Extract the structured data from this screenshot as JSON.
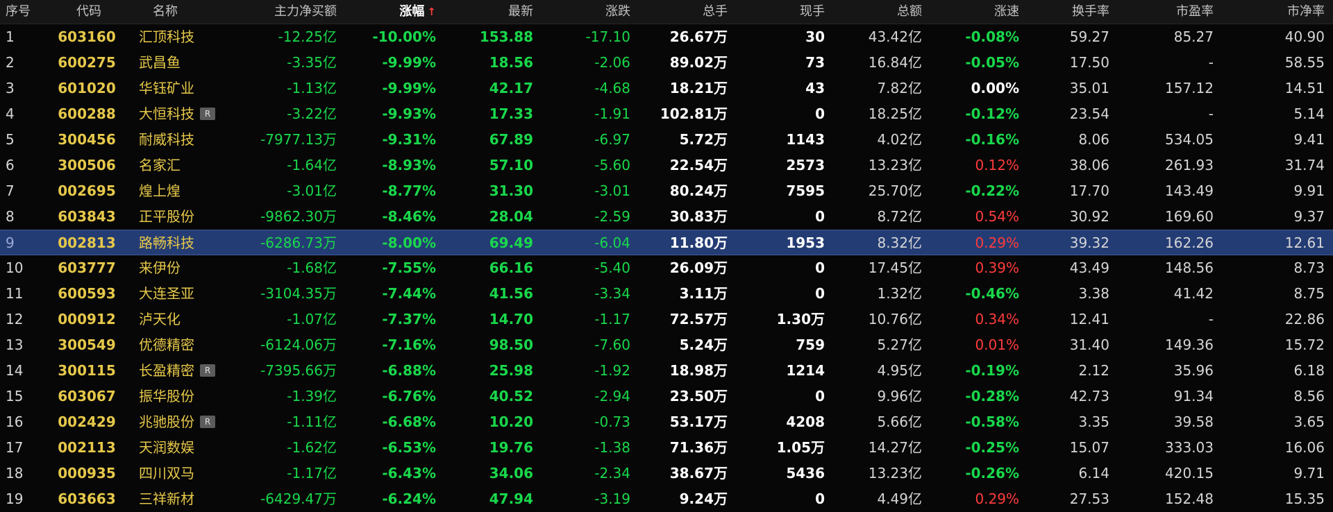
{
  "columns": [
    {
      "key": "idx",
      "label": "序号"
    },
    {
      "key": "code",
      "label": "代码"
    },
    {
      "key": "name",
      "label": "名称"
    },
    {
      "key": "main",
      "label": "主力净买额"
    },
    {
      "key": "pct",
      "label": "涨幅",
      "sorted": true
    },
    {
      "key": "last",
      "label": "最新"
    },
    {
      "key": "chg",
      "label": "涨跌"
    },
    {
      "key": "vol",
      "label": "总手"
    },
    {
      "key": "cur",
      "label": "现手"
    },
    {
      "key": "amt",
      "label": "总额"
    },
    {
      "key": "spd",
      "label": "涨速"
    },
    {
      "key": "turn",
      "label": "换手率"
    },
    {
      "key": "pe",
      "label": "市盈率"
    },
    {
      "key": "pb",
      "label": "市净率"
    }
  ],
  "sort_arrow": "↑",
  "badge_text": "R",
  "selected_row": 9,
  "colors": {
    "up": "#ff3b3b",
    "down": "#19d84b",
    "code": "#e6c84a",
    "selected_bg": "#243c74"
  },
  "rows": [
    {
      "idx": "1",
      "code": "603160",
      "name": "汇顶科技",
      "badge": false,
      "main": "-12.25亿",
      "pct": "-10.00%",
      "last": "153.88",
      "chg": "-17.10",
      "vol": "26.67万",
      "cur": "30",
      "amt": "43.42亿",
      "spd": "-0.08%",
      "spd_dir": "down",
      "turn": "59.27",
      "pe": "85.27",
      "pb": "40.90"
    },
    {
      "idx": "2",
      "code": "600275",
      "name": "武昌鱼",
      "badge": false,
      "main": "-3.35亿",
      "pct": "-9.99%",
      "last": "18.56",
      "chg": "-2.06",
      "vol": "89.02万",
      "cur": "73",
      "amt": "16.84亿",
      "spd": "-0.05%",
      "spd_dir": "down",
      "turn": "17.50",
      "pe": "-",
      "pb": "58.55"
    },
    {
      "idx": "3",
      "code": "601020",
      "name": "华钰矿业",
      "badge": false,
      "main": "-1.13亿",
      "pct": "-9.99%",
      "last": "42.17",
      "chg": "-4.68",
      "vol": "18.21万",
      "cur": "43",
      "amt": "7.82亿",
      "spd": "0.00%",
      "spd_dir": "flat",
      "turn": "35.01",
      "pe": "157.12",
      "pb": "14.51"
    },
    {
      "idx": "4",
      "code": "600288",
      "name": "大恒科技",
      "badge": true,
      "main": "-3.22亿",
      "pct": "-9.93%",
      "last": "17.33",
      "chg": "-1.91",
      "vol": "102.81万",
      "cur": "0",
      "amt": "18.25亿",
      "spd": "-0.12%",
      "spd_dir": "down",
      "turn": "23.54",
      "pe": "-",
      "pb": "5.14"
    },
    {
      "idx": "5",
      "code": "300456",
      "name": "耐威科技",
      "badge": false,
      "main": "-7977.13万",
      "pct": "-9.31%",
      "last": "67.89",
      "chg": "-6.97",
      "vol": "5.72万",
      "cur": "1143",
      "amt": "4.02亿",
      "spd": "-0.16%",
      "spd_dir": "down",
      "turn": "8.06",
      "pe": "534.05",
      "pb": "9.41"
    },
    {
      "idx": "6",
      "code": "300506",
      "name": "名家汇",
      "badge": false,
      "main": "-1.64亿",
      "pct": "-8.93%",
      "last": "57.10",
      "chg": "-5.60",
      "vol": "22.54万",
      "cur": "2573",
      "amt": "13.23亿",
      "spd": "0.12%",
      "spd_dir": "up",
      "turn": "38.06",
      "pe": "261.93",
      "pb": "31.74"
    },
    {
      "idx": "7",
      "code": "002695",
      "name": "煌上煌",
      "badge": false,
      "main": "-3.01亿",
      "pct": "-8.77%",
      "last": "31.30",
      "chg": "-3.01",
      "vol": "80.24万",
      "cur": "7595",
      "amt": "25.70亿",
      "spd": "-0.22%",
      "spd_dir": "down",
      "turn": "17.70",
      "pe": "143.49",
      "pb": "9.91"
    },
    {
      "idx": "8",
      "code": "603843",
      "name": "正平股份",
      "badge": false,
      "main": "-9862.30万",
      "pct": "-8.46%",
      "last": "28.04",
      "chg": "-2.59",
      "vol": "30.83万",
      "cur": "0",
      "amt": "8.72亿",
      "spd": "0.54%",
      "spd_dir": "up",
      "turn": "30.92",
      "pe": "169.60",
      "pb": "9.37"
    },
    {
      "idx": "9",
      "code": "002813",
      "name": "路畅科技",
      "badge": false,
      "main": "-6286.73万",
      "pct": "-8.00%",
      "last": "69.49",
      "chg": "-6.04",
      "vol": "11.80万",
      "cur": "1953",
      "amt": "8.32亿",
      "spd": "0.29%",
      "spd_dir": "up",
      "turn": "39.32",
      "pe": "162.26",
      "pb": "12.61"
    },
    {
      "idx": "10",
      "code": "603777",
      "name": "来伊份",
      "badge": false,
      "main": "-1.68亿",
      "pct": "-7.55%",
      "last": "66.16",
      "chg": "-5.40",
      "vol": "26.09万",
      "cur": "0",
      "amt": "17.45亿",
      "spd": "0.39%",
      "spd_dir": "up",
      "turn": "43.49",
      "pe": "148.56",
      "pb": "8.73"
    },
    {
      "idx": "11",
      "code": "600593",
      "name": "大连圣亚",
      "badge": false,
      "main": "-3104.35万",
      "pct": "-7.44%",
      "last": "41.56",
      "chg": "-3.34",
      "vol": "3.11万",
      "cur": "0",
      "amt": "1.32亿",
      "spd": "-0.46%",
      "spd_dir": "down",
      "turn": "3.38",
      "pe": "41.42",
      "pb": "8.75"
    },
    {
      "idx": "12",
      "code": "000912",
      "name": "泸天化",
      "badge": false,
      "main": "-1.07亿",
      "pct": "-7.37%",
      "last": "14.70",
      "chg": "-1.17",
      "vol": "72.57万",
      "cur": "1.30万",
      "amt": "10.76亿",
      "spd": "0.34%",
      "spd_dir": "up",
      "turn": "12.41",
      "pe": "-",
      "pb": "22.86"
    },
    {
      "idx": "13",
      "code": "300549",
      "name": "优德精密",
      "badge": false,
      "main": "-6124.06万",
      "pct": "-7.16%",
      "last": "98.50",
      "chg": "-7.60",
      "vol": "5.24万",
      "cur": "759",
      "amt": "5.27亿",
      "spd": "0.01%",
      "spd_dir": "up",
      "turn": "31.40",
      "pe": "149.36",
      "pb": "15.72"
    },
    {
      "idx": "14",
      "code": "300115",
      "name": "长盈精密",
      "badge": true,
      "main": "-7395.66万",
      "pct": "-6.88%",
      "last": "25.98",
      "chg": "-1.92",
      "vol": "18.98万",
      "cur": "1214",
      "amt": "4.95亿",
      "spd": "-0.19%",
      "spd_dir": "down",
      "turn": "2.12",
      "pe": "35.96",
      "pb": "6.18"
    },
    {
      "idx": "15",
      "code": "603067",
      "name": "振华股份",
      "badge": false,
      "main": "-1.39亿",
      "pct": "-6.76%",
      "last": "40.52",
      "chg": "-2.94",
      "vol": "23.50万",
      "cur": "0",
      "amt": "9.96亿",
      "spd": "-0.28%",
      "spd_dir": "down",
      "turn": "42.73",
      "pe": "91.34",
      "pb": "8.56"
    },
    {
      "idx": "16",
      "code": "002429",
      "name": "兆驰股份",
      "badge": true,
      "main": "-1.11亿",
      "pct": "-6.68%",
      "last": "10.20",
      "chg": "-0.73",
      "vol": "53.17万",
      "cur": "4208",
      "amt": "5.66亿",
      "spd": "-0.58%",
      "spd_dir": "down",
      "turn": "3.35",
      "pe": "39.58",
      "pb": "3.65"
    },
    {
      "idx": "17",
      "code": "002113",
      "name": "天润数娱",
      "badge": false,
      "main": "-1.62亿",
      "pct": "-6.53%",
      "last": "19.76",
      "chg": "-1.38",
      "vol": "71.36万",
      "cur": "1.05万",
      "amt": "14.27亿",
      "spd": "-0.25%",
      "spd_dir": "down",
      "turn": "15.07",
      "pe": "333.03",
      "pb": "16.06"
    },
    {
      "idx": "18",
      "code": "000935",
      "name": "四川双马",
      "badge": false,
      "main": "-1.17亿",
      "pct": "-6.43%",
      "last": "34.06",
      "chg": "-2.34",
      "vol": "38.67万",
      "cur": "5436",
      "amt": "13.23亿",
      "spd": "-0.26%",
      "spd_dir": "down",
      "turn": "6.14",
      "pe": "420.15",
      "pb": "9.71"
    },
    {
      "idx": "19",
      "code": "603663",
      "name": "三祥新材",
      "badge": false,
      "main": "-6429.47万",
      "pct": "-6.24%",
      "last": "47.94",
      "chg": "-3.19",
      "vol": "9.24万",
      "cur": "0",
      "amt": "4.49亿",
      "spd": "0.29%",
      "spd_dir": "up",
      "turn": "27.53",
      "pe": "152.48",
      "pb": "15.35"
    }
  ]
}
